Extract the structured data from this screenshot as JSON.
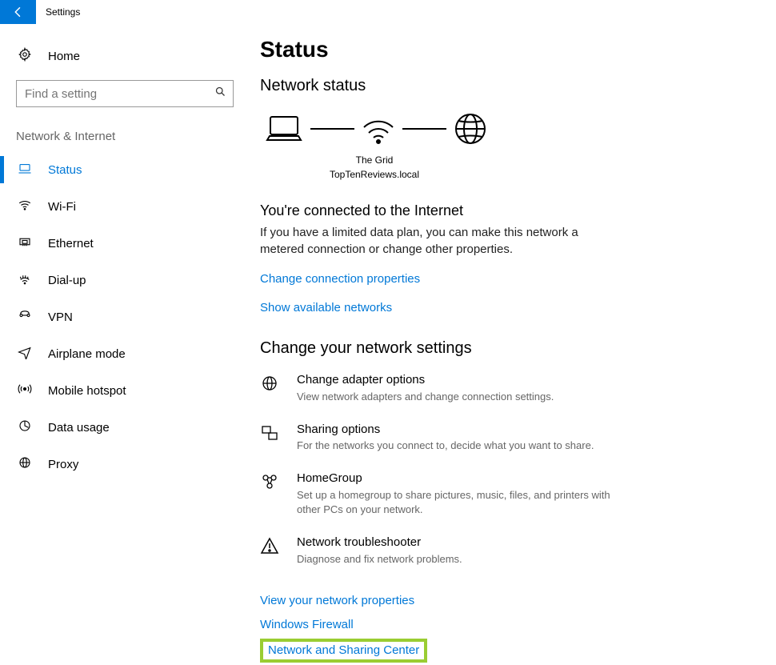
{
  "titlebar": {
    "title": "Settings"
  },
  "sidebar": {
    "home_label": "Home",
    "search_placeholder": "Find a setting",
    "category_label": "Network & Internet",
    "items": [
      {
        "label": "Status"
      },
      {
        "label": "Wi-Fi"
      },
      {
        "label": "Ethernet"
      },
      {
        "label": "Dial-up"
      },
      {
        "label": "VPN"
      },
      {
        "label": "Airplane mode"
      },
      {
        "label": "Mobile hotspot"
      },
      {
        "label": "Data usage"
      },
      {
        "label": "Proxy"
      }
    ]
  },
  "main": {
    "page_title": "Status",
    "network_status_heading": "Network status",
    "wifi_name": "The Grid",
    "wifi_domain": "TopTenReviews.local",
    "connected_heading": "You're connected to the Internet",
    "connected_desc": "If you have a limited data plan, you can make this network a metered connection or change other properties.",
    "link_change_conn": "Change connection properties",
    "link_show_available": "Show available networks",
    "change_settings_heading": "Change your network settings",
    "options": [
      {
        "title": "Change adapter options",
        "desc": "View network adapters and change connection settings."
      },
      {
        "title": "Sharing options",
        "desc": "For the networks you connect to, decide what you want to share."
      },
      {
        "title": "HomeGroup",
        "desc": "Set up a homegroup to share pictures, music, files, and printers with other PCs on your network."
      },
      {
        "title": "Network troubleshooter",
        "desc": "Diagnose and fix network problems."
      }
    ],
    "link_view_props": "View your network properties",
    "link_firewall": "Windows Firewall",
    "link_sharing_center": "Network and Sharing Center"
  }
}
